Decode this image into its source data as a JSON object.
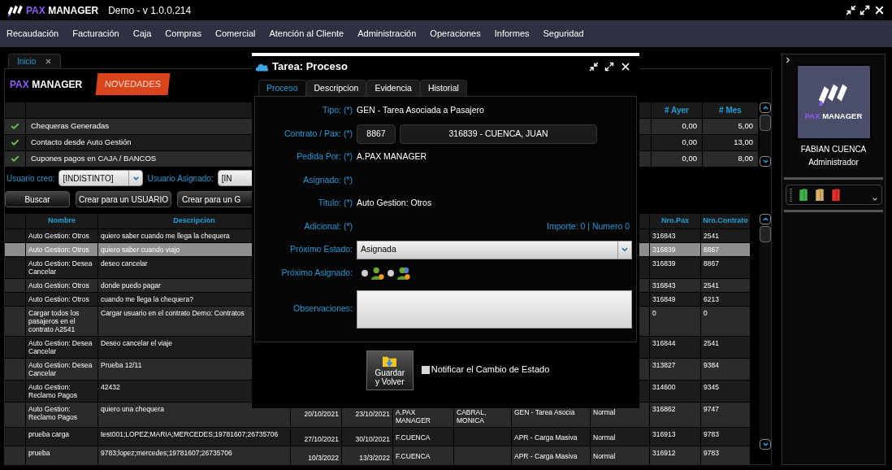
{
  "app": {
    "brand": {
      "accent": "PAX",
      "name": "MANAGER"
    },
    "title": "Demo - v 1.0.0.214"
  },
  "menu": [
    "Recaudación",
    "Facturación",
    "Caja",
    "Compras",
    "Comercial",
    "Atención al Cliente",
    "Administración",
    "Operaciones",
    "Informes",
    "Seguridad"
  ],
  "tabs": [
    {
      "label": "Inicio",
      "selected": true
    }
  ],
  "home": {
    "brand": {
      "accent": "PAX",
      "name": "MANAGER"
    },
    "news_badge": "NOVEDADES",
    "summary": {
      "columns": [
        "# Ayer",
        "# Mes"
      ],
      "rows": [
        {
          "label": "Chequeras Generadas",
          "ayer": "0,00",
          "mes": "5,00"
        },
        {
          "label": "Contacto desde Auto Gestión",
          "ayer": "0,00",
          "mes": "13,00"
        },
        {
          "label": "Cupones pagos en CAJA / BANCOS",
          "ayer": "0,00",
          "mes": "8,00"
        }
      ]
    },
    "filters": [
      {
        "label": "Usuario creo:",
        "value": "[INDISTINTO]"
      },
      {
        "label": "Usuario Asignado:",
        "value": "[IN"
      }
    ],
    "buttons": [
      "Buscar",
      "Crear para un USUARIO",
      "Crear para un G"
    ],
    "tasks": {
      "columns": [
        "Nombre",
        "Descripcion",
        "Nro.Pax",
        "Nro.Contrato"
      ],
      "rows": [
        {
          "selected": false,
          "nombre": "Auto Gestion: Otros",
          "descripcion": "quiero saber cuando me llega la chequera",
          "nro_pax": "316843",
          "nro_contrato": "2541"
        },
        {
          "selected": true,
          "nombre": "Auto Gestion: Otros",
          "descripcion": "quiero saber cuando viajo",
          "nro_pax": "316839",
          "nro_contrato": "8867"
        },
        {
          "selected": false,
          "nombre": "Auto Gestion: Desea Cancelar",
          "descripcion": "deseo cancelar",
          "nro_pax": "316839",
          "nro_contrato": "8867"
        },
        {
          "selected": false,
          "nombre": "Auto Gestion: Otros",
          "descripcion": "donde puedo pagar",
          "nro_pax": "316843",
          "nro_contrato": "2541"
        },
        {
          "selected": false,
          "nombre": "Auto Gestion: Otros",
          "descripcion": "cuando me llega la chequera?",
          "nro_pax": "316849",
          "nro_contrato": "6213"
        },
        {
          "selected": false,
          "nombre": "Cargar todos los pasajeros en el contrato A2541",
          "descripcion": "Cargar usuario en el contrato Demo: Contratos",
          "nro_pax": "0",
          "nro_contrato": "0"
        },
        {
          "selected": false,
          "nombre": "Auto Gestion: Desea Cancelar",
          "descripcion": "Deseo cancelar el viaje",
          "nro_pax": "316844",
          "nro_contrato": "2541"
        },
        {
          "selected": false,
          "nombre": "Auto Gestion: Desea Cancelar",
          "descripcion": "Prueba 12/11",
          "nro_pax": "313827",
          "nro_contrato": "9384"
        },
        {
          "selected": false,
          "nombre": "Auto Gestion: Reclamo Pagos",
          "descripcion": "42432",
          "nro_pax": "314600",
          "nro_contrato": "9345"
        },
        {
          "selected": false,
          "nombre": "Auto Gestion: Reclamo Pagos",
          "descripcion": "quiero una chequera",
          "fecha_1": "20/10/2021",
          "fecha_2": "23/10/2021",
          "column_5": "A.PAX MANAGER",
          "column_6": "CABRAL, MONICA",
          "column_7": "GEN - Tarea Asocia",
          "column_8": "Normal",
          "nro_pax": "316862",
          "nro_contrato": "9747"
        },
        {
          "selected": false,
          "nombre": "prueba carga",
          "descripcion": "test001;LOPEZ;MARIA;MERCEDES;19781607;26735706",
          "fecha_1": "27/10/2021",
          "fecha_2": "30/10/2021",
          "column_5": "F.CUENCA",
          "column_7": "APR - Carga Masiva",
          "column_8": "Normal",
          "nro_pax": "316913",
          "nro_contrato": "9783"
        },
        {
          "selected": false,
          "nombre": "prueba",
          "descripcion": "9783;lopez;mercedes;19781607;26735706",
          "fecha_1": "10/3/2022",
          "fecha_2": "13/3/2022",
          "column_5": "F.CUENCA",
          "column_7": "APR - Carga Masiva",
          "column_8": "Normal",
          "nro_pax": "316912",
          "nro_contrato": "9783"
        }
      ]
    }
  },
  "dialog": {
    "title": "Tarea: Proceso",
    "tabs": [
      {
        "label": "Proceso",
        "selected": true
      },
      {
        "label": "Descripcion",
        "selected": false
      },
      {
        "label": "Evidencia",
        "selected": false
      },
      {
        "label": "Historial",
        "selected": false
      }
    ],
    "fields": [
      {
        "kind": "text",
        "label": "Tipo: (*)",
        "value": "GEN - Tarea Asociada a Pasajero"
      },
      {
        "kind": "pair",
        "label": "Contrato / Pax: (*)",
        "values": [
          "8867",
          "316839 - CUENCA, JUAN"
        ]
      },
      {
        "kind": "text",
        "label": "Pedida Por: (*)",
        "value": "A.PAX MANAGER"
      },
      {
        "kind": "text",
        "label": "Asignado: (*)"
      },
      {
        "kind": "text",
        "label": "Titulo: (*)",
        "value": "Auto Gestion: Otros"
      },
      {
        "kind": "text",
        "label": "Adicional: (*)",
        "extra": "Importe: 0 | Numero 0"
      },
      {
        "kind": "select",
        "label": "Próximo Estado:",
        "value": "Asignada"
      },
      {
        "kind": "radio",
        "label": "Próximo Asignado:",
        "options": [
          {
            "kind": "user",
            "selected": false
          },
          {
            "kind": "group",
            "selected": false
          }
        ]
      },
      {
        "kind": "textarea",
        "label": "Observaciones:"
      }
    ],
    "save_button": "Guardar y Volver",
    "notify": {
      "label": "Notificar el Cambio de Estado",
      "checked": false
    }
  },
  "user": {
    "brand": {
      "accent": "PAX",
      "name": "MANAGER"
    },
    "name": "FABIAN CUENCA",
    "role": "Administrador"
  }
}
